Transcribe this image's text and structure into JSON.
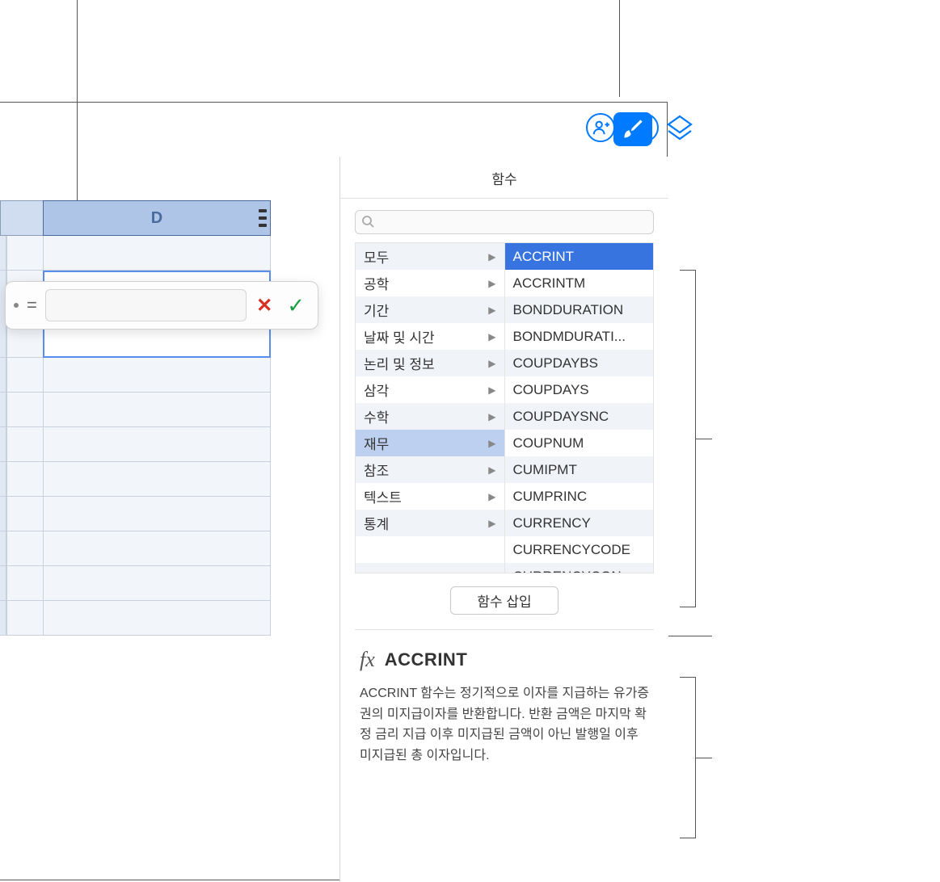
{
  "toolbar": {
    "collab_icon": "collaborate",
    "more_icon": "more"
  },
  "spreadsheet": {
    "column_d_label": "D"
  },
  "formula_editor": {
    "equals": "=",
    "value": "",
    "cancel": "✕",
    "accept": "✓"
  },
  "sidebar": {
    "title": "함수",
    "search_placeholder": "",
    "categories": [
      "모두",
      "공학",
      "기간",
      "날짜 및 시간",
      "논리 및 정보",
      "삼각",
      "수학",
      "재무",
      "참조",
      "텍스트",
      "통계"
    ],
    "selected_category_index": 7,
    "functions": [
      "ACCRINT",
      "ACCRINTM",
      "BONDDURATION",
      "BONDMDURATI...",
      "COUPDAYBS",
      "COUPDAYS",
      "COUPDAYSNC",
      "COUPNUM",
      "CUMIPMT",
      "CUMPRINC",
      "CURRENCY",
      "CURRENCYCODE",
      "CURRENCYCON..."
    ],
    "selected_function_index": 0,
    "insert_label": "함수 삽입",
    "description": {
      "fx": "fx",
      "title": "ACCRINT",
      "body": "ACCRINT 함수는 정기적으로 이자를 지급하는 유가증권의 미지급이자를 반환합니다. 반환 금액은 마지막 확정 금리 지급 이후 미지급된 금액이 아닌 발행일 이후 미지급된 총 이자입니다."
    }
  }
}
